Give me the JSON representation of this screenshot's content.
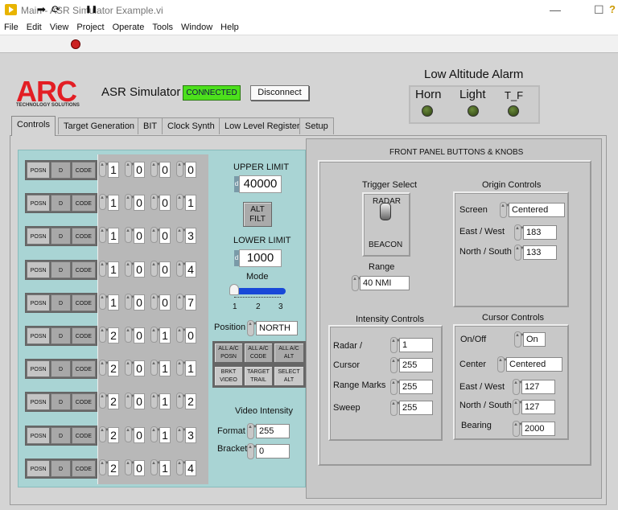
{
  "window": {
    "title": "Main - ASR Simulator Example.vi",
    "minimize": "—",
    "maximize": "☐"
  },
  "menu": [
    "File",
    "Edit",
    "View",
    "Project",
    "Operate",
    "Tools",
    "Window",
    "Help"
  ],
  "toolbar": {
    "run": "➡",
    "run_continuous": "⟳",
    "pause": "❚❚",
    "help": "?"
  },
  "header": {
    "logo": "ARC",
    "logo_sub": "TECHNOLOGY SOLUTIONS",
    "app_name": "ASR Simulator",
    "status": "CONNECTED",
    "status_color": "#4ce01c",
    "disconnect": "Disconnect"
  },
  "alarm": {
    "title": "Low Altitude Alarm",
    "indicators": [
      "Horn",
      "Light",
      "T_F"
    ]
  },
  "tabs": [
    "Controls",
    "Target Generation",
    "BIT",
    "Clock Synth",
    "Low Level Register",
    "Setup"
  ],
  "controls": {
    "row_buttons": {
      "posn": "POSN",
      "d": "D",
      "code": "CODE"
    },
    "codes": [
      [
        "1",
        "0",
        "0",
        "0"
      ],
      [
        "1",
        "0",
        "0",
        "1"
      ],
      [
        "1",
        "0",
        "0",
        "3"
      ],
      [
        "1",
        "0",
        "0",
        "4"
      ],
      [
        "1",
        "0",
        "0",
        "7"
      ],
      [
        "2",
        "0",
        "1",
        "0"
      ],
      [
        "2",
        "0",
        "1",
        "1"
      ],
      [
        "2",
        "0",
        "1",
        "2"
      ],
      [
        "2",
        "0",
        "1",
        "3"
      ],
      [
        "2",
        "0",
        "1",
        "4"
      ]
    ],
    "upper_limit_label": "UPPER LIMIT",
    "upper_limit": "40000",
    "alt_filt": "ALT FILT",
    "lower_limit_label": "LOWER LIMIT",
    "lower_limit": "1000",
    "mode_label": "Mode",
    "mode_ticks": [
      "1",
      "2",
      "3"
    ],
    "mode_value": 1,
    "position_label": "Position",
    "position": "NORTH",
    "buttons": [
      "ALL A/C POSN",
      "ALL A/C CODE",
      "ALL A/C ALT",
      "BRKT VIDEO",
      "TARGET TRAIL",
      "SELECT ALT"
    ],
    "video_intensity_label": "Video Intensity",
    "format_label": "Format",
    "format": "255",
    "bracket_label": "Bracket",
    "bracket": "0"
  },
  "front_panel": {
    "title": "FRONT PANEL BUTTONS & KNOBS",
    "trigger": {
      "label": "Trigger Select",
      "top": "RADAR",
      "bottom": "BEACON"
    },
    "range": {
      "label": "Range",
      "value": "40 NMI"
    },
    "origin": {
      "title": "Origin Controls",
      "screen_label": "Screen",
      "screen": "Centered",
      "ew_label": "East / West",
      "ew": "183",
      "ns_label": "North / South",
      "ns": "133"
    },
    "intensity": {
      "title": "Intensity Controls",
      "radar_label": "Radar /",
      "radar": "1",
      "cursor_label": "Cursor",
      "cursor": "255",
      "range_marks_label": "Range Marks",
      "range_marks": "255",
      "sweep_label": "Sweep",
      "sweep": "255"
    },
    "cursor": {
      "title": "Cursor Controls",
      "onoff_label": "On/Off",
      "onoff": "On",
      "center_label": "Center",
      "center": "Centered",
      "ew_label": "East / West",
      "ew": "127",
      "ns_label": "North / South",
      "ns": "127",
      "bearing_label": "Bearing",
      "bearing": "2000"
    }
  }
}
